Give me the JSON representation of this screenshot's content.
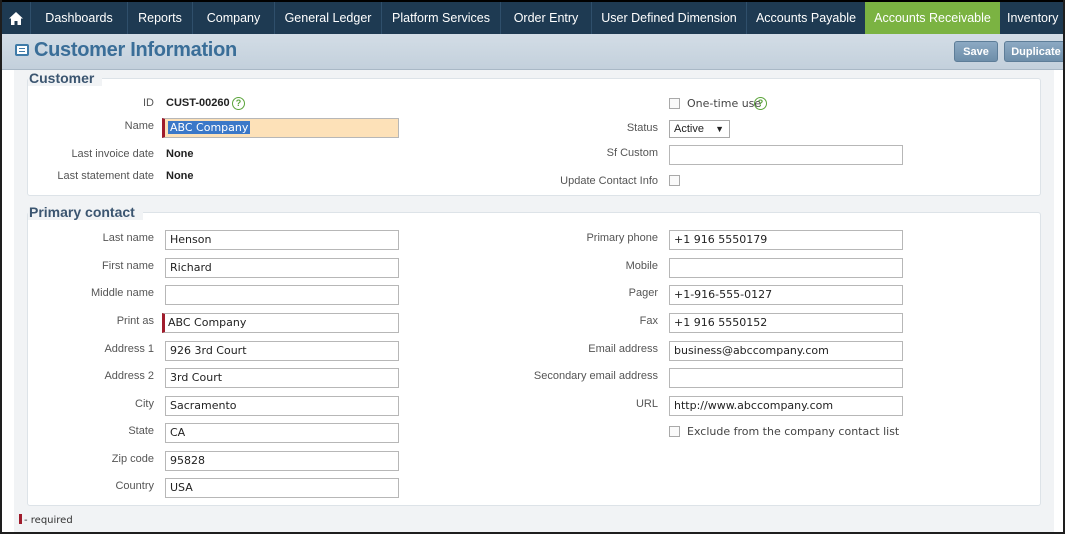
{
  "nav": {
    "home_icon": "home-icon",
    "items": [
      {
        "label": "Dashboards"
      },
      {
        "label": "Reports"
      },
      {
        "label": "Company"
      },
      {
        "label": "General Ledger"
      },
      {
        "label": "Platform Services"
      },
      {
        "label": "Order Entry"
      },
      {
        "label": "User Defined Dimension"
      },
      {
        "label": "Accounts Payable"
      },
      {
        "label": "Accounts Receivable",
        "active": true
      },
      {
        "label": "Inventory"
      }
    ]
  },
  "header": {
    "title": "Customer Information",
    "save_label": "Save",
    "duplicate_label": "Duplicate"
  },
  "customer": {
    "section_title": "Customer",
    "id_label": "ID",
    "id_value": "CUST-00260",
    "name_label": "Name",
    "name_value": "ABC Company",
    "last_invoice_label": "Last invoice date",
    "last_invoice_value": "None",
    "last_statement_label": "Last statement date",
    "last_statement_value": "None",
    "one_time_label": "One-time use",
    "status_label": "Status",
    "status_value": "Active",
    "sf_custom_label": "Sf Custom",
    "sf_custom_value": "",
    "update_contact_label": "Update Contact Info"
  },
  "contact": {
    "section_title": "Primary contact",
    "left": [
      {
        "label": "Last name",
        "value": "Henson"
      },
      {
        "label": "First name",
        "value": "Richard"
      },
      {
        "label": "Middle name",
        "value": ""
      },
      {
        "label": "Print as",
        "value": "ABC Company",
        "required": true
      },
      {
        "label": "Address 1",
        "value": "926 3rd Court"
      },
      {
        "label": "Address 2",
        "value": "3rd Court"
      },
      {
        "label": "City",
        "value": "Sacramento"
      },
      {
        "label": "State",
        "value": "CA"
      },
      {
        "label": "Zip code",
        "value": "95828"
      },
      {
        "label": "Country",
        "value": "USA"
      }
    ],
    "right": [
      {
        "label": "Primary phone",
        "value": "+1 916 5550179"
      },
      {
        "label": "Mobile",
        "value": ""
      },
      {
        "label": "Pager",
        "value": "+1-916-555-0127"
      },
      {
        "label": "Fax",
        "value": "+1 916 5550152"
      },
      {
        "label": "Email address",
        "value": "business@abccompany.com"
      },
      {
        "label": "Secondary email address",
        "value": ""
      },
      {
        "label": "URL",
        "value": "http://www.abccompany.com"
      }
    ],
    "exclude_label": "Exclude from the company contact list"
  },
  "footer": {
    "required_note": "- required"
  },
  "colors": {
    "nav_bg": "#1e3a52",
    "nav_active": "#7bb342",
    "title_color": "#3a6e98",
    "required_mark": "#a01c2c",
    "name_highlight": "#fde1b8"
  }
}
